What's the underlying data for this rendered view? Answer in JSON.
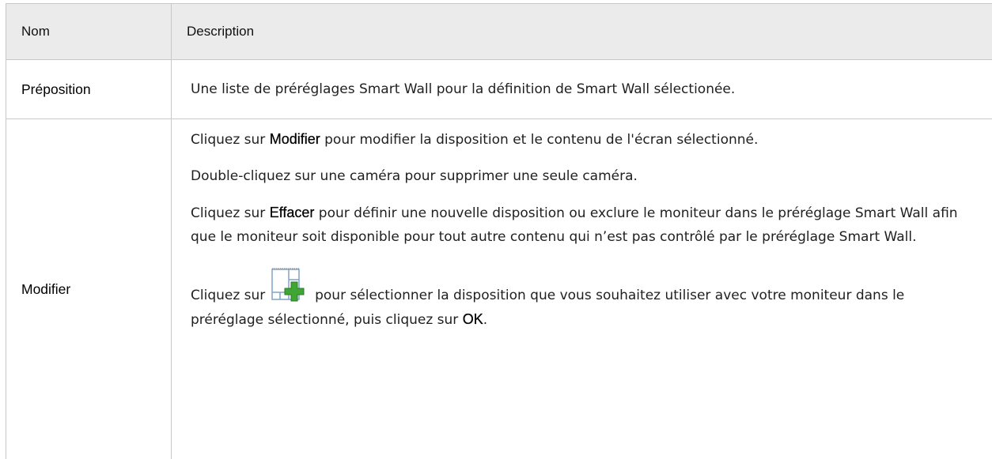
{
  "table": {
    "headers": {
      "name": "Nom",
      "description": "Description"
    },
    "rows": [
      {
        "name": "Préposition",
        "description": "Une liste de préréglages Smart Wall pour la définition de Smart Wall sélectionée."
      },
      {
        "name": "Modifier",
        "p1_pre": "Cliquez sur ",
        "p1_bold": "Modifier",
        "p1_post": " pour modifier la disposition et le contenu de l'écran sélectionné.",
        "p2": "Double-cliquez sur une caméra pour supprimer une seule caméra.",
        "p3_pre": "Cliquez sur ",
        "p3_bold": "Effacer",
        "p3_post": " pour définir une nouvelle disposition ou exclure le moniteur dans le préréglage Smart Wall afin que le moniteur soit disponible pour tout autre contenu qui n’est pas contrôlé par le préréglage Smart Wall.",
        "p4_pre": "Cliquez sur ",
        "p4_icon": "add-layout-icon",
        "p4_post": " pour sélectionner la disposition que vous souhaitez utiliser avec votre moniteur dans le préréglage sélectionné, puis cliquez sur ",
        "p4_bold": "OK",
        "p4_end": "."
      }
    ]
  },
  "colors": {
    "header_bg": "#ebebeb",
    "border": "#c8c8c8",
    "icon_plus": "#3fa535"
  }
}
